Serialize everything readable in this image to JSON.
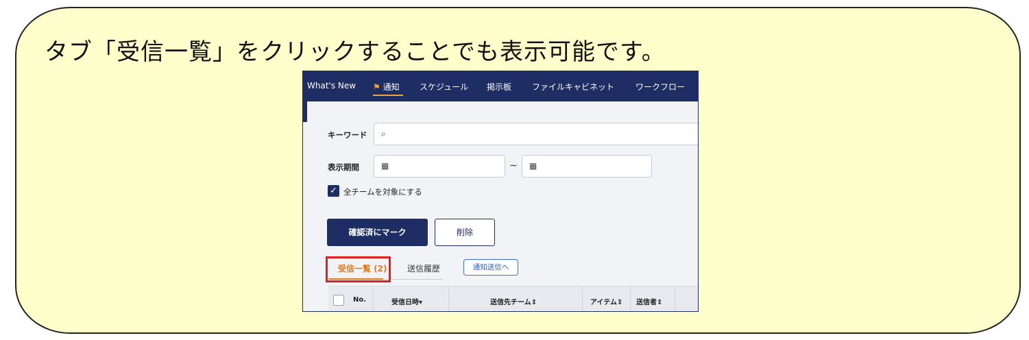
{
  "caption": "タブ「受信一覧」をクリックすることでも表示可能です。",
  "nav": {
    "items": [
      "What's New",
      "通知",
      "スケジュール",
      "掲示板",
      "ファイルキャビネット",
      "ワークフロー"
    ],
    "active_index": 1,
    "flag_icon": "flag-icon"
  },
  "form": {
    "keyword_label": "キーワード",
    "keyword_value": "",
    "period_label": "表示期間",
    "period_from": "",
    "period_to": "",
    "tilde": "~",
    "all_teams_label": "全チームを対象にする",
    "all_teams_checked": true
  },
  "buttons": {
    "mark_confirmed": "確認済にマーク",
    "delete": "削除"
  },
  "tabs": {
    "inbox": "受信一覧 (2)",
    "sent_history": "送信履歴",
    "to_send": "通知送信へ"
  },
  "table": {
    "headers": [
      "No.",
      "受信日時▾",
      "送信先チーム⇕",
      "アイテム⇕",
      "送信者⇕"
    ]
  },
  "colors": {
    "nav_bg": "#1e2d63",
    "accent_orange": "#e0791a",
    "highlight_red": "#e21d1d",
    "callout_bg": "#ffffcc"
  }
}
